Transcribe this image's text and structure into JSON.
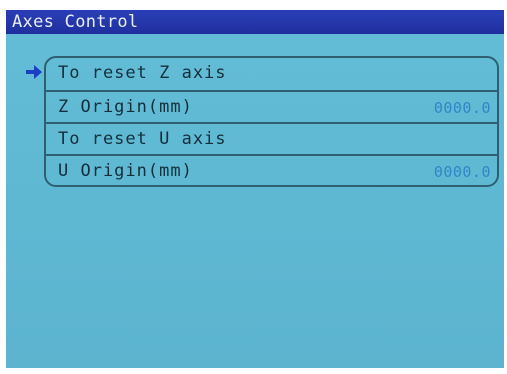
{
  "window": {
    "title": "Axes Control"
  },
  "cursor_icon": "right-arrow-icon",
  "colors": {
    "screen_bg": "#5fb9d3",
    "titlebar_bg": "#1f2f9e",
    "value_text": "#2f86c8"
  },
  "menu": {
    "items": [
      {
        "label": "To reset Z axis",
        "value": ""
      },
      {
        "label": "Z Origin(mm)",
        "value": "0000.0"
      },
      {
        "label": "To reset U axis",
        "value": ""
      },
      {
        "label": "U Origin(mm)",
        "value": "0000.0"
      }
    ]
  }
}
